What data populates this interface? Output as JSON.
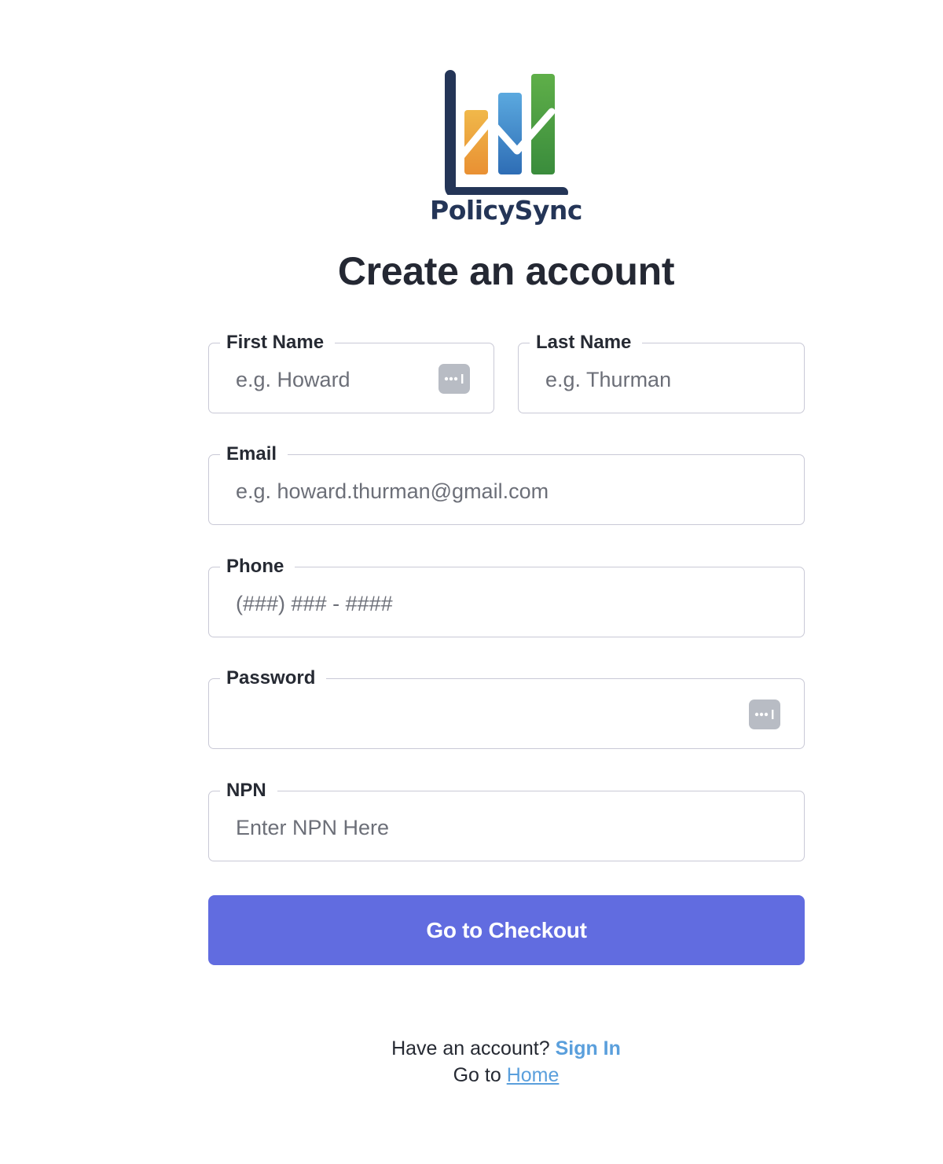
{
  "brand": {
    "name": "PolicySync",
    "logo_colors": {
      "frame": "#243557",
      "bar_orange_top": "#f0b84a",
      "bar_orange_bottom": "#e99033",
      "bar_blue_top": "#5ba9df",
      "bar_blue_bottom": "#2e6db5",
      "bar_green_top": "#5faf49",
      "bar_green_bottom": "#3a8c3c"
    }
  },
  "page": {
    "title": "Create an account"
  },
  "form": {
    "first_name": {
      "label": "First Name",
      "placeholder": "e.g. Howard",
      "value": ""
    },
    "last_name": {
      "label": "Last Name",
      "placeholder": "e.g. Thurman",
      "value": ""
    },
    "email": {
      "label": "Email",
      "placeholder": "e.g. howard.thurman@gmail.com",
      "value": ""
    },
    "phone": {
      "label": "Phone",
      "placeholder": "(###) ### - ####",
      "value": ""
    },
    "password": {
      "label": "Password",
      "placeholder": "",
      "value": ""
    },
    "npn": {
      "label": "NPN",
      "placeholder": "Enter NPN Here",
      "value": ""
    },
    "submit_label": "Go to Checkout",
    "submit_color": "#616ce0"
  },
  "footer": {
    "have_account_text": "Have an account?",
    "signin_link": "Sign In",
    "goto_text": "Go to",
    "home_link": "Home",
    "link_color": "#5a9fdc"
  },
  "icons": {
    "autofill": "password-autofill-icon"
  }
}
